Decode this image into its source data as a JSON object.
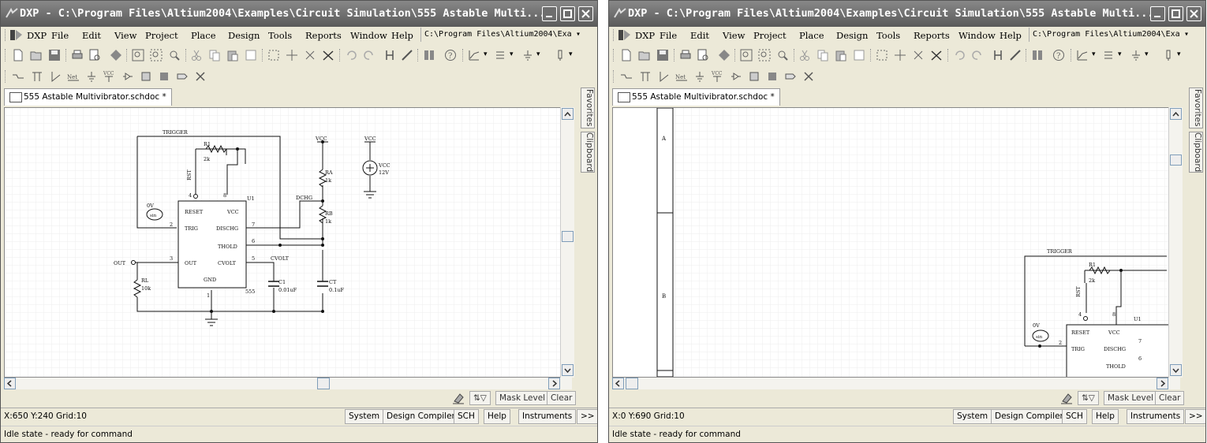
{
  "window_title": "DXP - C:\\Program Files\\Altium2004\\Examples\\Circuit Simulation\\555 Astable Multi...",
  "menu": [
    "DXP",
    "File",
    "Edit",
    "View",
    "Project",
    "Place",
    "Design",
    "Tools",
    "Reports",
    "Window",
    "Help"
  ],
  "path_box": "C:\\Program Files\\Altium2004\\Exa",
  "document_tab": "555 Astable Multivibrator.schdoc *",
  "side_tabs": [
    "Favorites",
    "Clipboard"
  ],
  "mask_controls": {
    "mask_level": "Mask Level",
    "clear": "Clear"
  },
  "status_tabs": [
    "System",
    "Design Compiler",
    "SCH",
    "Help",
    "Instruments",
    ">>"
  ],
  "idle_text": "Idle state - ready for command",
  "left_window": {
    "coords": "X:650 Y:240   Grid:10"
  },
  "right_window": {
    "coords": "X:0 Y:690   Grid:10"
  },
  "schematic": {
    "trigger": "TRIGGER",
    "r1": "R1",
    "r1_val": "2k",
    "rst": "RST",
    "pin4": "4",
    "pin8": "8",
    "u1": "U1",
    "vcc": "VCC",
    "ra": "RA",
    "ra_val": "1k",
    "rb": "RB",
    "rb_val": "1k",
    "dchg": "DCHG",
    "reset": "RESET",
    "trig": "TRIG",
    "out": "OUT",
    "gnd": "GND",
    "disch": "DISCHG",
    "thold": "THOLD",
    "cvolt": "CVOLT",
    "pin2": "2",
    "pin3": "3",
    "pin5": "5",
    "pin6": "6",
    "pin7": "7",
    "pin1": "1",
    "ic_type": "555",
    "c1": "C1",
    "c1_val": "0.01uF",
    "ct": "CT",
    "ct_val": "0.1uF",
    "vout_label": "CVOLT",
    "rl": "RL",
    "rl_val": "10k",
    "out_port": "OUT",
    "zero_v": "0V",
    "src_label": "VCC",
    "src_val": "12V",
    "sine": "sin",
    "sheet_row_a": "A",
    "sheet_row_b": "B"
  }
}
